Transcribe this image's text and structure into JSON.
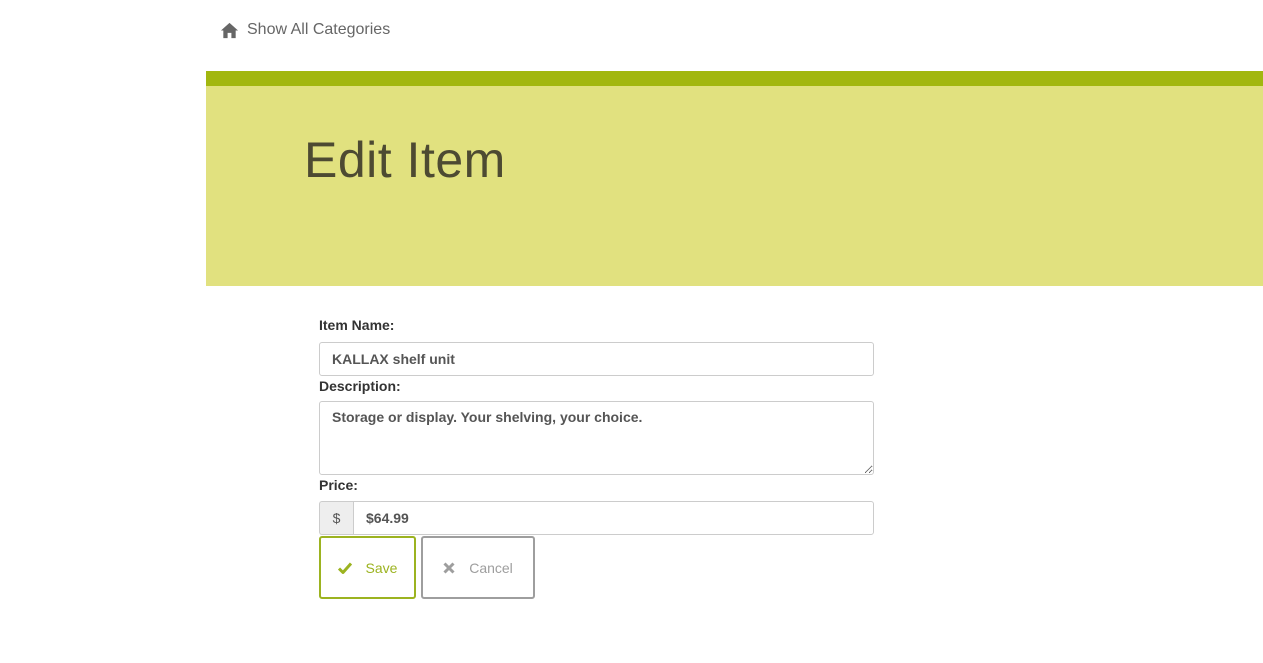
{
  "nav": {
    "home_link_label": "Show All Categories",
    "home_icon": "home-icon"
  },
  "theme": {
    "accent_bar": "#a2b70f",
    "hero_bg": "#e1e17f",
    "title_color": "#4d4a32",
    "save_color": "#9cb320",
    "cancel_color": "#9e9e9e"
  },
  "header": {
    "title": "Edit Item"
  },
  "form": {
    "name_label": "Item Name:",
    "name_value": "KALLAX shelf unit",
    "description_label": "Description:",
    "description_value": "Storage or display. Your shelving, your choice.",
    "price_label": "Price:",
    "price_prefix": "$",
    "price_value": "$64.99"
  },
  "buttons": {
    "save_label": "Save",
    "save_icon": "checkmark-icon",
    "cancel_label": "Cancel",
    "cancel_icon": "x-icon"
  }
}
